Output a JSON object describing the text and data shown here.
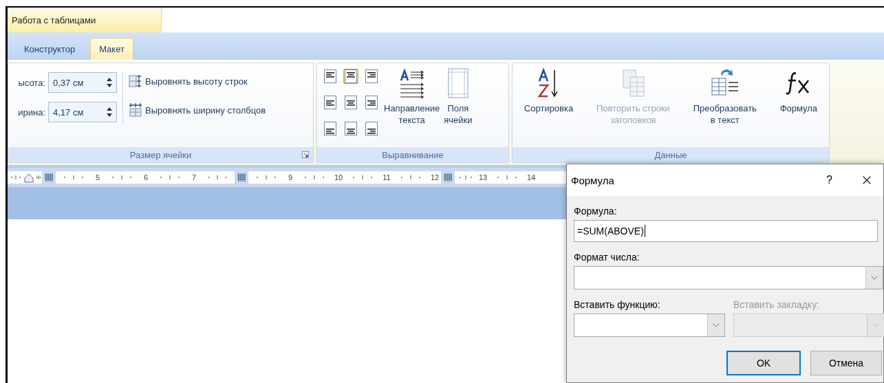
{
  "context_tab": {
    "label": "Работа с таблицами"
  },
  "tabs": [
    {
      "label": "Конструктор",
      "selected": false
    },
    {
      "label": "Макет",
      "selected": true
    }
  ],
  "ribbon": {
    "groups": [
      {
        "kind": "cell_size",
        "label": "Размер ячейки",
        "fields": [
          {
            "label": "ысота:",
            "value": "0,37 см"
          },
          {
            "label": "ирина:",
            "value": "4,17 см"
          }
        ],
        "buttons": [
          {
            "kind": "rows",
            "label": "Выровнять высоту строк"
          },
          {
            "kind": "cols",
            "label": "Выровнять ширину столбцов"
          }
        ]
      },
      {
        "kind": "alignment",
        "label": "Выравнивание",
        "cells": [
          {
            "selected": false
          },
          {
            "selected": true
          },
          {
            "selected": false
          },
          {
            "selected": false
          },
          {
            "selected": false
          },
          {
            "selected": false
          },
          {
            "selected": false
          },
          {
            "selected": false
          },
          {
            "selected": false
          }
        ],
        "buttons": [
          {
            "kind": "direction",
            "label": "Направление\nтекста",
            "disabled": false
          },
          {
            "kind": "margins",
            "label": "Поля\nячейки",
            "disabled": false
          }
        ]
      },
      {
        "kind": "data",
        "label": "Данные",
        "buttons": [
          {
            "kind": "sort",
            "label": "Сортировка",
            "disabled": false
          },
          {
            "kind": "repeat",
            "label": "Повторить строки\nзаголовков",
            "disabled": true
          },
          {
            "kind": "convert",
            "label": "Преобразовать\nв текст",
            "disabled": false
          },
          {
            "kind": "formula",
            "label": "Формула",
            "disabled": false
          }
        ]
      }
    ]
  },
  "ruler": [
    {
      "kind": "indent"
    },
    {
      "kind": "column_marker"
    },
    {
      "kind": "number",
      "label": "5"
    },
    {
      "kind": "number",
      "label": "6"
    },
    {
      "kind": "number",
      "label": "7"
    },
    {
      "kind": "column_marker"
    },
    {
      "kind": "number",
      "label": "9"
    },
    {
      "kind": "number",
      "label": "10"
    },
    {
      "kind": "number",
      "label": "11"
    },
    {
      "kind": "number",
      "label": "12"
    },
    {
      "kind": "number",
      "label": "13",
      "marker_before": true
    },
    {
      "kind": "number",
      "label": "14"
    }
  ],
  "dialog": {
    "title": "Формула",
    "help": "?",
    "formula": {
      "label": "Формула:",
      "value": "=SUM(ABOVE)",
      "focused": true
    },
    "number_format": {
      "label": "Формат числа:"
    },
    "function": {
      "label": "Вставить функцию:",
      "disabled": false
    },
    "bookmark": {
      "label": "Вставить закладку:",
      "disabled": true
    },
    "buttons": [
      {
        "label": "OK",
        "default": true
      },
      {
        "label": "Отмена",
        "default": false
      }
    ]
  }
}
